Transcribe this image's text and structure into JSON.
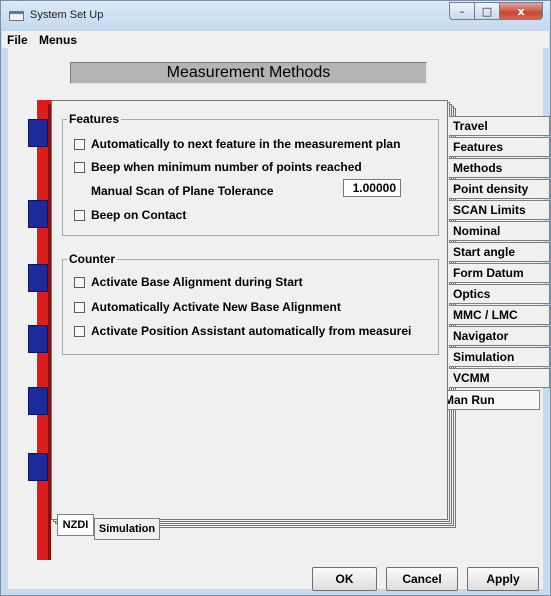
{
  "window": {
    "title": "System Set Up",
    "minimize": "–",
    "maximize": "□",
    "close": "x"
  },
  "menu": {
    "items": [
      "File",
      "Menus"
    ]
  },
  "header": {
    "title": "Measurement Methods"
  },
  "features": {
    "title": "Features",
    "auto_next": "Automatically to next feature in the measurement plan",
    "beep_min": "Beep when minimum number of points reached",
    "manual_scan_label": "Manual Scan of Plane Tolerance",
    "manual_scan_value": "1.00000",
    "beep_contact": "Beep on Contact"
  },
  "counter": {
    "title": "Counter",
    "base_align_start": "Activate Base Alignment during Start",
    "auto_new_base": "Automatically Activate New Base Alignment",
    "position_assistant": "Activate Position Assistant automatically from measurei"
  },
  "right_tabs": [
    "Travel",
    "Features",
    "Methods",
    "Point density",
    "SCAN Limits",
    "Nominal",
    "Start angle",
    "Form Datum",
    "Optics",
    "MMC / LMC",
    "Navigator",
    "Simulation",
    "VCMM"
  ],
  "active_tab": "Man Run",
  "bottom_tabs": [
    "NZDI",
    "Simulation"
  ],
  "buttons": {
    "ok": "OK",
    "cancel": "Cancel",
    "apply": "Apply"
  },
  "colors": {
    "binder_red": "#dd1c1c",
    "ring_blue": "#1c2a9c"
  }
}
